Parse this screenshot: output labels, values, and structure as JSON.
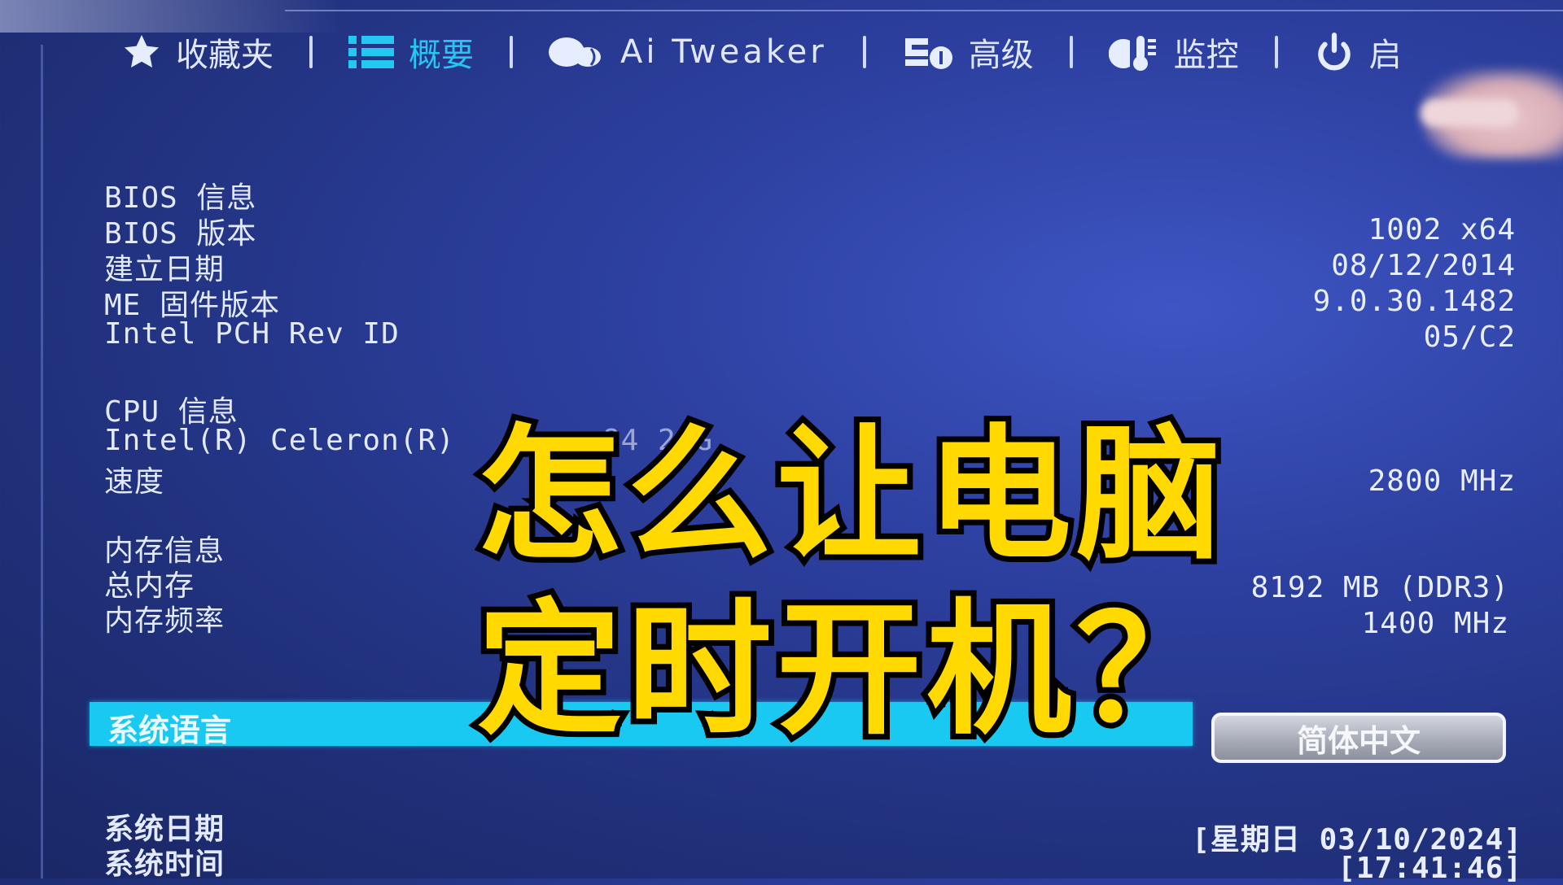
{
  "nav": {
    "items": [
      {
        "label": "收藏夹",
        "icon": "star-icon",
        "active": false
      },
      {
        "label": "概要",
        "icon": "list-icon",
        "active": true
      },
      {
        "label": "Ai Tweaker",
        "icon": "tweaker-icon",
        "active": false
      },
      {
        "label": "高级",
        "icon": "advanced-icon",
        "active": false
      },
      {
        "label": "监控",
        "icon": "thermometer-icon",
        "active": false
      },
      {
        "label": "启",
        "icon": "power-icon",
        "active": false
      }
    ],
    "active_color": "#25c6f2"
  },
  "bios_info": {
    "heading": "BIOS 信息",
    "rows": [
      {
        "label": "BIOS 版本",
        "value": "1002 x64"
      },
      {
        "label": "建立日期",
        "value": "08/12/2014"
      },
      {
        "label": "ME 固件版本",
        "value": "9.0.30.1482"
      },
      {
        "label": "Intel PCH Rev ID",
        "value": "05/C2"
      }
    ]
  },
  "cpu_info": {
    "heading": "CPU 信息",
    "model": "Intel(R) Celeron(R)",
    "model_partial_tail": "84  2  G",
    "speed_label": "速度",
    "speed_value": "2800 MHz"
  },
  "memory_info": {
    "heading": "内存信息",
    "rows": [
      {
        "label": "总内存",
        "value": "8192 MB (DDR3)"
      },
      {
        "label": "内存频率",
        "value": "1400 MHz"
      }
    ]
  },
  "language": {
    "label": "系统语言",
    "value": "简体中文",
    "highlight_color": "#19c9f2"
  },
  "datetime": {
    "date_label": "系统日期",
    "date_value": "[星期日 03/10/2024]",
    "time_label": "系统时间",
    "time_value": "[17:41:46]"
  },
  "overlay_title": {
    "line1": "怎么让电脑",
    "line2": "定时开机？",
    "color": "#ffd900"
  }
}
